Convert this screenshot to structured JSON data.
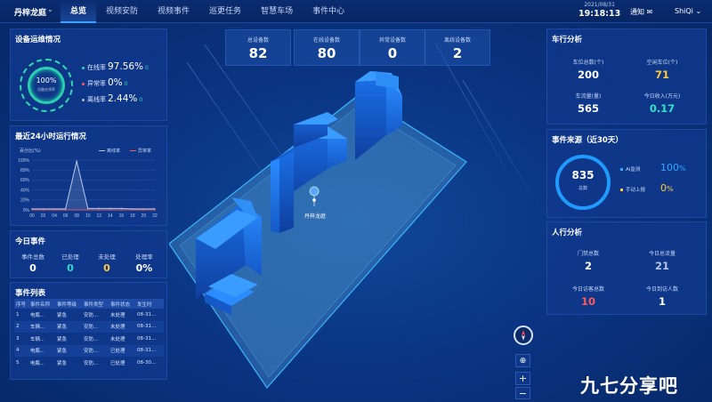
{
  "header": {
    "site_name": "丹梓龙庭",
    "site_dropdown_icon": "chevron-down-icon",
    "nav": [
      "总览",
      "视频安防",
      "视频事件",
      "巡更任务",
      "智慧车场",
      "事件中心"
    ],
    "active_nav": 0,
    "date": "2021/08/31",
    "time": "19:18:13",
    "notify_label": "通知",
    "notify_icon": "mail-icon",
    "user_name": "ShiQi",
    "user_dropdown_icon": "chevron-down-icon"
  },
  "device_ops": {
    "title": "设备运维情况",
    "ring_value": "100%",
    "ring_sub": "设备在线率",
    "rows": [
      {
        "label": "在线率",
        "value": "97.56%",
        "extra": "0",
        "color": "#2fd9b0"
      },
      {
        "label": "异常率",
        "value": "0%",
        "extra": "0",
        "color": "#ff5a5a"
      },
      {
        "label": "离线率",
        "value": "2.44%",
        "extra": "0",
        "color": "#b0bccc"
      }
    ]
  },
  "runtime": {
    "title": "最近24小时运行情况",
    "legend": [
      {
        "name": "离线率",
        "color": "#b9c6e6"
      },
      {
        "name": "异常率",
        "color": "#ff5a5a"
      }
    ]
  },
  "chart_data": {
    "type": "line",
    "ylabel": "百分比(%)",
    "x": [
      "00",
      "02",
      "04",
      "06",
      "08",
      "10",
      "12",
      "14",
      "16",
      "18",
      "20",
      "22"
    ],
    "ylim": [
      0,
      100
    ],
    "yticks": [
      "0%",
      "20%",
      "40%",
      "60%",
      "80%",
      "100%"
    ],
    "series": [
      {
        "name": "离线率",
        "values": [
          2,
          2,
          2,
          2,
          98,
          3,
          3,
          3,
          3,
          2,
          2,
          2
        ]
      },
      {
        "name": "异常率",
        "values": [
          0,
          0,
          0,
          0,
          0,
          0,
          0,
          0,
          0,
          0,
          0,
          0
        ]
      }
    ]
  },
  "today_events": {
    "title": "今日事件",
    "items": [
      {
        "label": "事件总数",
        "value": "0",
        "color": "#ffffff"
      },
      {
        "label": "已处理",
        "value": "0",
        "color": "#2fd9d0"
      },
      {
        "label": "未处理",
        "value": "0",
        "color": "#ffc93a"
      },
      {
        "label": "处理率",
        "value": "0%",
        "color": "#ffffff"
      }
    ]
  },
  "event_list": {
    "title": "事件列表",
    "columns": [
      "序号",
      "事件名称",
      "事件等级",
      "事件类型",
      "事件状态",
      "发生时"
    ],
    "rows": [
      [
        "1",
        "电瓶...",
        "紧急",
        "安防...",
        "未处理",
        "08-31..."
      ],
      [
        "2",
        "车辆...",
        "紧急",
        "安防...",
        "未处理",
        "08-31..."
      ],
      [
        "3",
        "车辆...",
        "紧急",
        "安防...",
        "未处理",
        "08-31..."
      ],
      [
        "4",
        "电瓶...",
        "紧急",
        "安防...",
        "已处理",
        "08-31..."
      ],
      [
        "5",
        "电瓶...",
        "紧急",
        "安防...",
        "已处理",
        "08-30..."
      ]
    ]
  },
  "summary": [
    {
      "label": "总设备数",
      "value": "82"
    },
    {
      "label": "在线设备数",
      "value": "80"
    },
    {
      "label": "异常设备数",
      "value": "0"
    },
    {
      "label": "离线设备数",
      "value": "2"
    }
  ],
  "map": {
    "pin_label": "丹梓龙庭",
    "pin_icon": "map-pin-icon"
  },
  "vehicle": {
    "title": "车行分析",
    "items": [
      {
        "label": "车位总数(个)",
        "value": "200",
        "color": "#ffffff"
      },
      {
        "label": "空闲车位(个)",
        "value": "71",
        "color": "#ffc93a"
      },
      {
        "label": "车流量(量)",
        "value": "565",
        "color": "#ffffff"
      },
      {
        "label": "今日收入(万元)",
        "value": "0.17",
        "color": "#2fe3c8"
      }
    ]
  },
  "event_source": {
    "title": "事件来源（近30天）",
    "total": "835",
    "total_label": "总数",
    "rows": [
      {
        "label": "AI监测",
        "pct": "100",
        "unit": "%",
        "color": "#2fa8ff"
      },
      {
        "label": "手动上报",
        "pct": "0",
        "unit": "%",
        "color": "#ffc93a"
      }
    ]
  },
  "people": {
    "title": "人行分析",
    "items": [
      {
        "label": "门禁总数",
        "value": "2",
        "color": "#ffffff"
      },
      {
        "label": "今日总流量",
        "value": "21",
        "color": "#b9c6e6"
      },
      {
        "label": "今日访客总数",
        "value": "10",
        "color": "#ff5a5a"
      },
      {
        "label": "今日到访人数",
        "value": "1",
        "color": "#ffffff"
      }
    ]
  },
  "map_controls": {
    "locate_icon": "locate-icon",
    "zoom_in": "+",
    "zoom_out": "−"
  },
  "watermark": "九七分享吧"
}
